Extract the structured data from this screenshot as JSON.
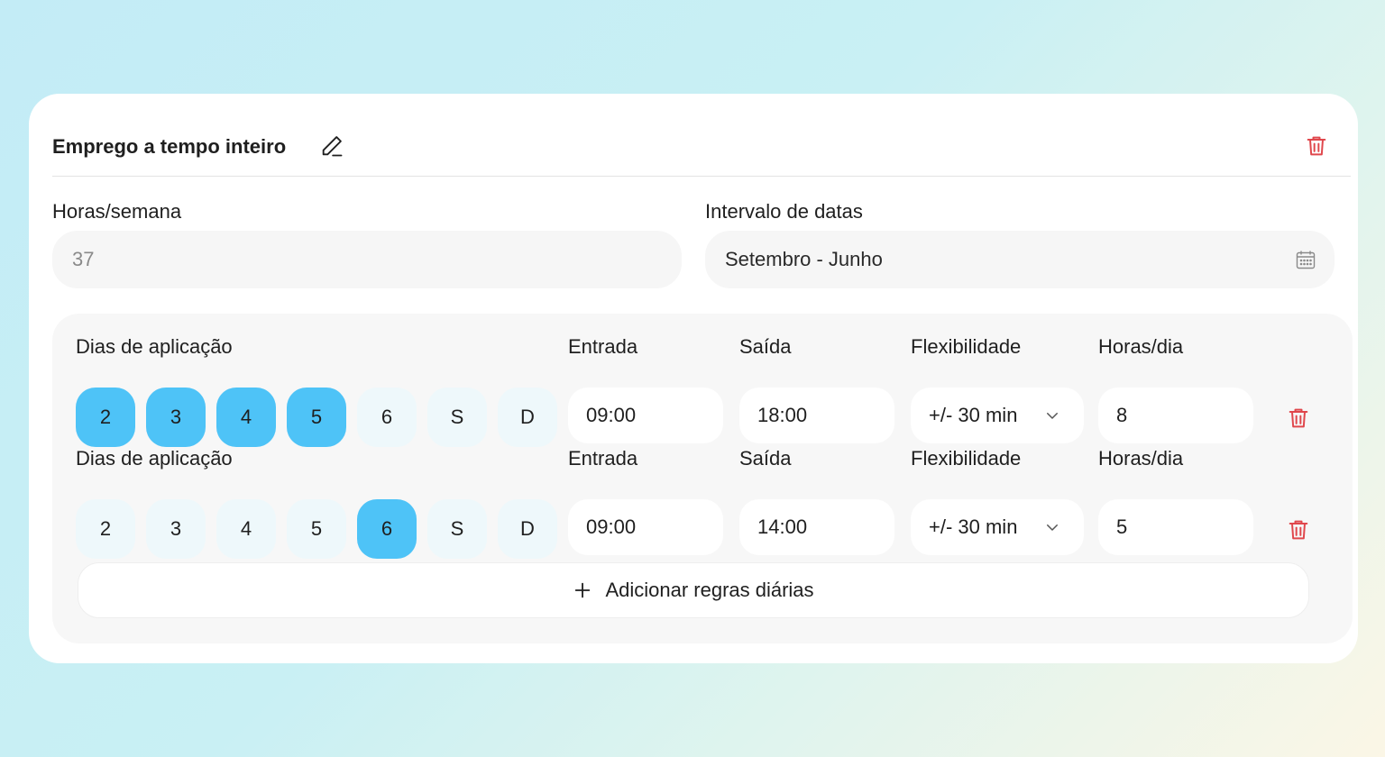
{
  "card": {
    "title": "Emprego a tempo inteiro",
    "hours_week": {
      "label": "Horas/semana",
      "value": "37"
    },
    "date_range": {
      "label": "Intervalo de datas",
      "value": "Setembro - Junho"
    }
  },
  "rules": [
    {
      "days_label": "Dias de aplicação",
      "days": [
        {
          "label": "2",
          "selected": true
        },
        {
          "label": "3",
          "selected": true
        },
        {
          "label": "4",
          "selected": true
        },
        {
          "label": "5",
          "selected": true
        },
        {
          "label": "6",
          "selected": false
        },
        {
          "label": "S",
          "selected": false
        },
        {
          "label": "D",
          "selected": false
        }
      ],
      "entrada_label": "Entrada",
      "entrada": "09:00",
      "saida_label": "Saída",
      "saida": "18:00",
      "flex_label": "Flexibilidade",
      "flex": "+/- 30 min",
      "horas_label": "Horas/dia",
      "horas": "8"
    },
    {
      "days_label": "Dias de aplicação",
      "days": [
        {
          "label": "2",
          "selected": false
        },
        {
          "label": "3",
          "selected": false
        },
        {
          "label": "4",
          "selected": false
        },
        {
          "label": "5",
          "selected": false
        },
        {
          "label": "6",
          "selected": true
        },
        {
          "label": "S",
          "selected": false
        },
        {
          "label": "D",
          "selected": false
        }
      ],
      "entrada_label": "Entrada",
      "entrada": "09:00",
      "saida_label": "Saída",
      "saida": "14:00",
      "flex_label": "Flexibilidade",
      "flex": "+/- 30 min",
      "horas_label": "Horas/dia",
      "horas": "5"
    }
  ],
  "add_rule_label": "Adicionar regras diárias",
  "colors": {
    "accent": "#4ec3f7",
    "danger": "#e0474c",
    "day_idle": "#eef8fb"
  },
  "icons": {
    "edit": "pencil-icon",
    "delete": "trash-icon",
    "calendar": "calendar-icon",
    "dropdown": "chevron-down-icon",
    "add": "plus-icon"
  }
}
